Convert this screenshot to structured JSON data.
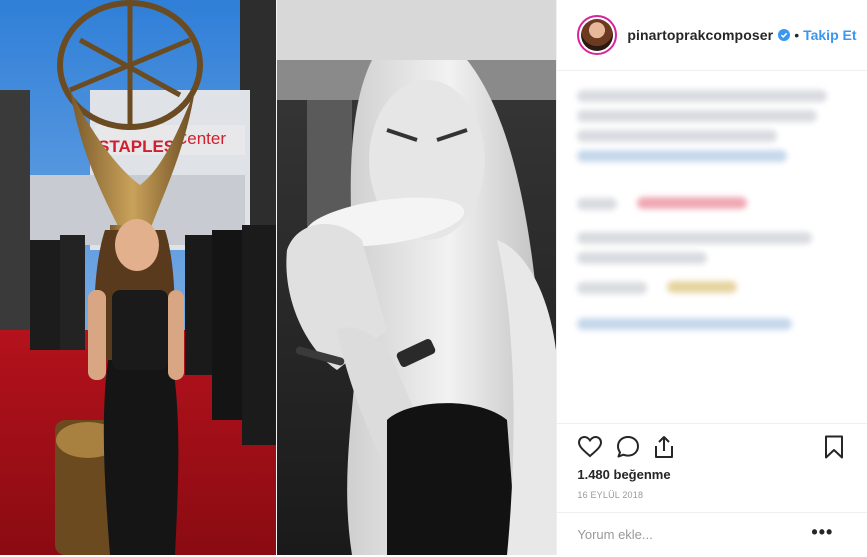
{
  "header": {
    "username": "pinartoprakcomposer",
    "separator": "•",
    "follow_label": "Takip Et",
    "verified_icon": "verified-badge-icon",
    "accent_color": "#3897f0"
  },
  "post": {
    "likes_text": "1.480 beğenme",
    "date_text": "16 EYLÜL 2018"
  },
  "comment_box": {
    "placeholder": "Yorum ekle...",
    "more_label": "•••"
  },
  "icons": [
    "heart-icon",
    "comment-icon",
    "share-icon",
    "bookmark-icon"
  ]
}
